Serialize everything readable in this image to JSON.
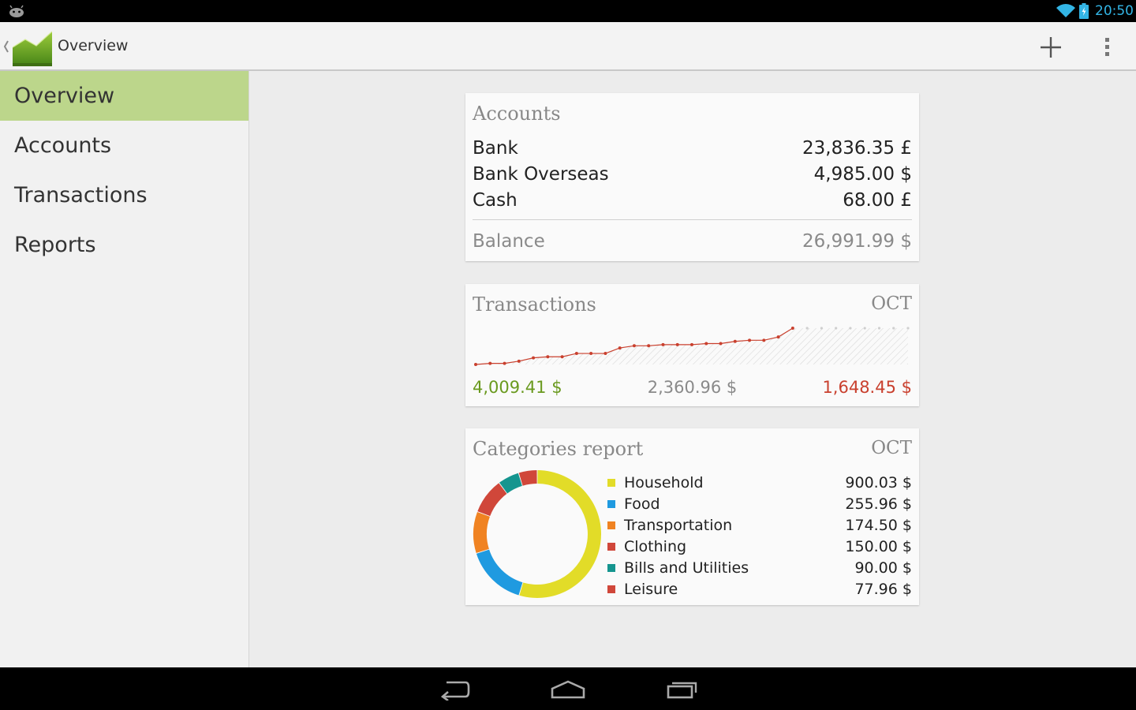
{
  "status_bar": {
    "time": "20:50",
    "icons": [
      "android-notification-icon",
      "wifi-icon",
      "battery-charging-icon"
    ]
  },
  "action_bar": {
    "title": "Overview",
    "icons": [
      "up-caret-icon",
      "app-chart-icon",
      "add-icon",
      "overflow-menu-icon"
    ]
  },
  "sidebar": {
    "items": [
      {
        "label": "Overview",
        "active": true
      },
      {
        "label": "Accounts",
        "active": false
      },
      {
        "label": "Transactions",
        "active": false
      },
      {
        "label": "Reports",
        "active": false
      }
    ]
  },
  "accounts_card": {
    "title": "Accounts",
    "rows": [
      {
        "name": "Bank",
        "amount": "23,836.35 £"
      },
      {
        "name": "Bank Overseas",
        "amount": "4,985.00 $"
      },
      {
        "name": "Cash",
        "amount": "68.00 £"
      }
    ],
    "balance_label": "Balance",
    "balance_amount": "26,991.99 $"
  },
  "transactions_card": {
    "title": "Transactions",
    "month": "OCT",
    "income": "4,009.41 $",
    "balance": "2,360.96 $",
    "expense": "1,648.45 $"
  },
  "categories_card": {
    "title": "Categories report",
    "month": "OCT",
    "items": [
      {
        "name": "Household",
        "amount": "900.03 $",
        "value": 900.03,
        "color": "#e2dc28"
      },
      {
        "name": "Food",
        "amount": "255.96 $",
        "value": 255.96,
        "color": "#1f9ae0"
      },
      {
        "name": "Transportation",
        "amount": "174.50 $",
        "value": 174.5,
        "color": "#f08322"
      },
      {
        "name": "Clothing",
        "amount": "150.00 $",
        "value": 150.0,
        "color": "#d0473a"
      },
      {
        "name": "Bills and Utilities",
        "amount": "90.00 $",
        "value": 90.0,
        "color": "#15958f"
      },
      {
        "name": "Leisure",
        "amount": "77.96 $",
        "value": 77.96,
        "color": "#d0473a"
      }
    ]
  },
  "chart_data": [
    {
      "type": "line",
      "title": "Transactions",
      "xlabel": "",
      "ylabel": "",
      "x": [
        1,
        2,
        3,
        4,
        5,
        6,
        7,
        8,
        9,
        10,
        11,
        12,
        13,
        14,
        15,
        16,
        17,
        18,
        19,
        20,
        21,
        22,
        23,
        24,
        25,
        26,
        27,
        28,
        29,
        30,
        31
      ],
      "series": [
        {
          "values": [
            0,
            1,
            1,
            3,
            6,
            7,
            7,
            10,
            10,
            10,
            15,
            17,
            17,
            18,
            18,
            18,
            19,
            19,
            21,
            22,
            22,
            25,
            33,
            null,
            null,
            null,
            null,
            null,
            null,
            null,
            null
          ]
        }
      ],
      "color": "#c9402e",
      "grid": false,
      "legend": "none"
    },
    {
      "type": "pie",
      "title": "Categories report",
      "categories": [
        "Household",
        "Food",
        "Transportation",
        "Clothing",
        "Bills and Utilities",
        "Leisure"
      ],
      "values": [
        900.03,
        255.96,
        174.5,
        150.0,
        90.0,
        77.96
      ],
      "colors": [
        "#e2dc28",
        "#1f9ae0",
        "#f08322",
        "#d0473a",
        "#15958f",
        "#d0473a"
      ],
      "donut": true,
      "legend": "right"
    }
  ],
  "nav_bar": {
    "icons": [
      "back-icon",
      "home-icon",
      "recent-apps-icon"
    ]
  }
}
